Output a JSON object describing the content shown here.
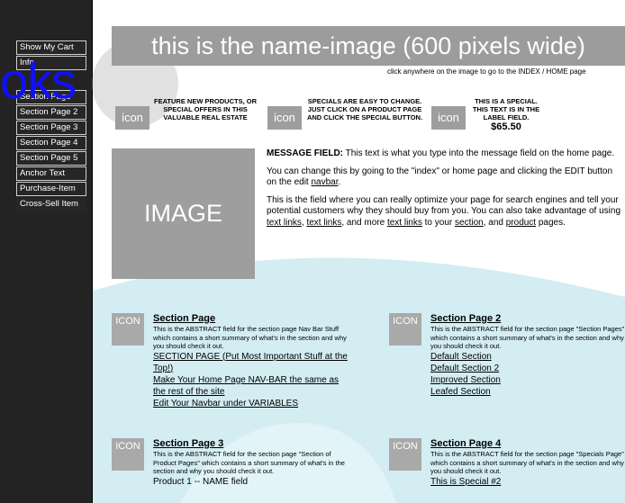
{
  "sidebar": {
    "items": [
      {
        "label": "Show My Cart"
      },
      {
        "label": "Info"
      },
      {
        "label": "Section Page"
      },
      {
        "label": "Section Page 2"
      },
      {
        "label": "Section Page 3"
      },
      {
        "label": "Section Page 4"
      },
      {
        "label": "Section Page 5"
      },
      {
        "label": "Anchor Text"
      },
      {
        "label": "Purchase-Item"
      },
      {
        "label": "Cross-Sell Item"
      }
    ],
    "watermark": "oks"
  },
  "banner": {
    "title": "this is the name-image (600 pixels wide)",
    "hint": "click anywhere on the image to go to the INDEX / HOME page"
  },
  "features": [
    {
      "icon": "icon",
      "text": "FEATURE NEW PRODUCTS, OR SPECIAL OFFERS IN THIS VALUABLE REAL ESTATE"
    },
    {
      "icon": "icon",
      "text": "SPECIALS ARE EASY TO CHANGE. JUST CLICK ON A PRODUCT PAGE AND CLICK THE SPECIAL BUTTON."
    },
    {
      "icon": "icon",
      "text": "THIS IS A SPECIAL. THIS TEXT IS IN THE LABEL FIELD.",
      "price": "$65.50"
    }
  ],
  "image_placeholder": "IMAGE",
  "message": {
    "label": "MESSAGE FIELD:",
    "p1": " This text is what you type into the message field on the home page.",
    "p2_a": "You can change this by going to the \"index\" or home page and clicking the EDIT button on the edit ",
    "p2_link": "navbar",
    "p2_b": ".",
    "p3_a": "This is the field where you can really optimize your page for search engines and tell your potential customers why they should buy from you. You can also take advantage of using ",
    "link1": "text links",
    "comma": ", ",
    "link2": "text links",
    "p3_b": ", and more ",
    "link3": "text links",
    "p3_c": " to your ",
    "link4": "section",
    "p3_d": ", and ",
    "link5": "product",
    "p3_e": " pages."
  },
  "sections": [
    {
      "icon": "ICON",
      "title": "Section Page",
      "abstract": "This is the ABSTRACT field for the section page Nav Bar Stuff which contains a short summary of what's in the section and why you should check it out.",
      "links": [
        "SECTION PAGE (Put Most Important Stuff at the Top!)",
        "Make Your Home Page NAV-BAR the same as the rest of the site",
        "Edit Your Navbar under VARIABLES"
      ]
    },
    {
      "icon": "ICON",
      "title": "Section Page 2",
      "abstract": "This is the ABSTRACT field for the section page \"Section Pages\" which contains a short summary of what's in the section and why you should check it out.",
      "links": [
        "Default Section",
        "Default Section 2",
        "Improved Section",
        "Leafed Section"
      ]
    },
    {
      "icon": "ICON",
      "title": "Section Page 3",
      "abstract": "This is the ABSTRACT field for the section page \"Section of Product Pages\" which contains a short summary of what's in the section and why you should check it out.",
      "links": [
        "Product 1 -- NAME field"
      ]
    },
    {
      "icon": "ICON",
      "title": "Section Page 4",
      "abstract": "This is the ABSTRACT field for the section page \"Specials Page\" which contains a short summary of what's in the section and why you should check it out.",
      "links": [
        "This is Special #2"
      ]
    }
  ],
  "colors": {
    "sidebar_bg": "#232323",
    "banner_bg": "#9c9c9c",
    "teal_overlay": "#bfe6ee",
    "watermark": "#1010ff"
  }
}
